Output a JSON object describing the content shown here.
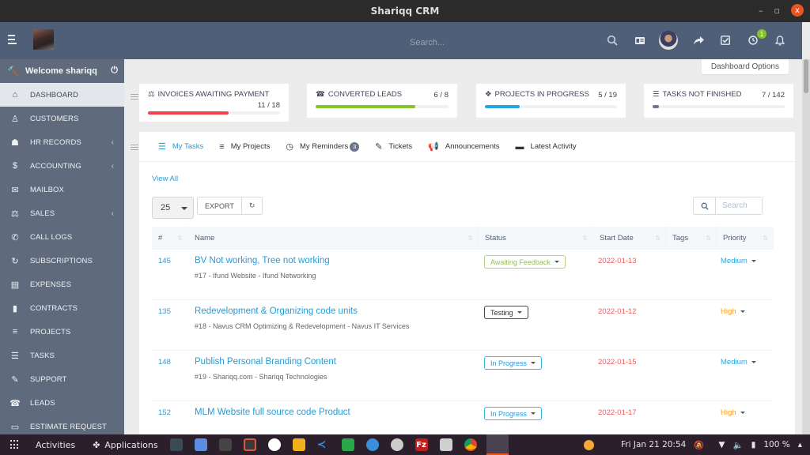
{
  "window": {
    "title": "Shariqq CRM",
    "minimize": "–",
    "maximize": "▫",
    "close": "x"
  },
  "header": {
    "search_placeholder": "Search...",
    "notification_count": "1"
  },
  "sidebar": {
    "welcome": "Welcome shariqq",
    "items": [
      {
        "label": "DASHBOARD",
        "icon": "home-icon",
        "glyph": "⌂",
        "active": true,
        "caret": false
      },
      {
        "label": "CUSTOMERS",
        "icon": "user-icon",
        "glyph": "♙",
        "caret": false
      },
      {
        "label": "HR RECORDS",
        "icon": "users-icon",
        "glyph": "☗",
        "caret": true
      },
      {
        "label": "ACCOUNTING",
        "icon": "dollar-icon",
        "glyph": "$",
        "caret": true
      },
      {
        "label": "MAILBOX",
        "icon": "envelope-icon",
        "glyph": "✉",
        "caret": false
      },
      {
        "label": "SALES",
        "icon": "balance-scale-icon",
        "glyph": "⚖",
        "caret": true
      },
      {
        "label": "CALL LOGS",
        "icon": "phone-icon",
        "glyph": "✆",
        "caret": false
      },
      {
        "label": "SUBSCRIPTIONS",
        "icon": "refresh-icon",
        "glyph": "↻",
        "caret": false
      },
      {
        "label": "EXPENSES",
        "icon": "file-text-icon",
        "glyph": "▤",
        "caret": false
      },
      {
        "label": "CONTRACTS",
        "icon": "file-icon",
        "glyph": "▮",
        "caret": false
      },
      {
        "label": "PROJECTS",
        "icon": "bars-icon",
        "glyph": "≡",
        "caret": false
      },
      {
        "label": "TASKS",
        "icon": "tasks-icon",
        "glyph": "☰",
        "caret": false
      },
      {
        "label": "SUPPORT",
        "icon": "ticket-icon",
        "glyph": "✎",
        "caret": false
      },
      {
        "label": "LEADS",
        "icon": "tty-icon",
        "glyph": "☎",
        "caret": false
      },
      {
        "label": "ESTIMATE REQUEST",
        "icon": "list-alt-icon",
        "glyph": "▭",
        "caret": false
      }
    ],
    "caret_glyph": "‹"
  },
  "dashboard_options": "Dashboard Options",
  "stats": [
    {
      "title": "INVOICES AWAITING PAYMENT",
      "value": "11 / 18",
      "fraction": 0.611,
      "color": "#f1404e",
      "icon": "balance-scale-icon",
      "glyph": "⚖"
    },
    {
      "title": "CONVERTED LEADS",
      "value": "6 / 8",
      "fraction": 0.75,
      "color": "#84c529",
      "icon": "tty-icon",
      "glyph": "☎"
    },
    {
      "title": "PROJECTS IN PROGRESS",
      "value": "5 / 19",
      "fraction": 0.263,
      "color": "#22a7e3",
      "icon": "cubes-icon",
      "glyph": "❖"
    },
    {
      "title": "TASKS NOT FINISHED",
      "value": "7 / 142",
      "fraction": 0.049,
      "color": "#6c7788",
      "icon": "tasks-icon",
      "glyph": "☰"
    }
  ],
  "tabs": [
    {
      "label": "My Tasks",
      "icon": "tasks-icon",
      "glyph": "☰",
      "active": true
    },
    {
      "label": "My Projects",
      "icon": "bars-icon",
      "glyph": "≡"
    },
    {
      "label": "My Reminders",
      "icon": "clock-icon",
      "glyph": "◷",
      "badge": "3"
    },
    {
      "label": "Tickets",
      "icon": "ticket-icon",
      "glyph": "✎"
    },
    {
      "label": "Announcements",
      "icon": "bullhorn-icon",
      "glyph": "📢"
    },
    {
      "label": "Latest Activity",
      "icon": "window-icon",
      "glyph": "▬"
    }
  ],
  "table": {
    "view_all": "View All",
    "page_length": "25",
    "export_label": "EXPORT",
    "search_placeholder": "Search",
    "columns": [
      "#",
      "Name",
      "Status",
      "Start Date",
      "Tags",
      "Priority"
    ],
    "rows": [
      {
        "id": "145",
        "name": "BV Not working, Tree not working",
        "sub": "#17 - Ifund Website - Ifund Networking",
        "status": "Awaiting Feedback",
        "status_color": "#b5d37c",
        "status_text_color": "#9dbd63",
        "start_date": "2022-01-13",
        "tags": "",
        "priority": "Medium",
        "priority_color": "#22a7e3"
      },
      {
        "id": "135",
        "name": "Redevelopment & Organizing code units",
        "sub": "#18 - Navus CRM Optimizing & Redevelopment - Navus IT Services",
        "status": "Testing",
        "status_color": "#444444",
        "status_text_color": "#333333",
        "start_date": "2022-01-12",
        "tags": "",
        "priority": "High",
        "priority_color": "#ff9e1b"
      },
      {
        "id": "148",
        "name": "Publish Personal Branding Content",
        "sub": "#19 - Shariqq.com - Shariqq Technologies",
        "status": "In Progress",
        "status_color": "#38b6e8",
        "status_text_color": "#2a9ad4",
        "start_date": "2022-01-15",
        "tags": "",
        "priority": "Medium",
        "priority_color": "#22a7e3"
      },
      {
        "id": "152",
        "name": "MLM Website full source code Product",
        "sub": "",
        "status": "In Progress",
        "status_color": "#38b6e8",
        "status_text_color": "#2a9ad4",
        "start_date": "2022-01-17",
        "tags": "",
        "priority": "High",
        "priority_color": "#ff9e1b"
      }
    ]
  },
  "taskbar": {
    "activities": "Activities",
    "applications": "Applications",
    "datetime": "Fri Jan 21  20:54",
    "battery": "100 %"
  }
}
